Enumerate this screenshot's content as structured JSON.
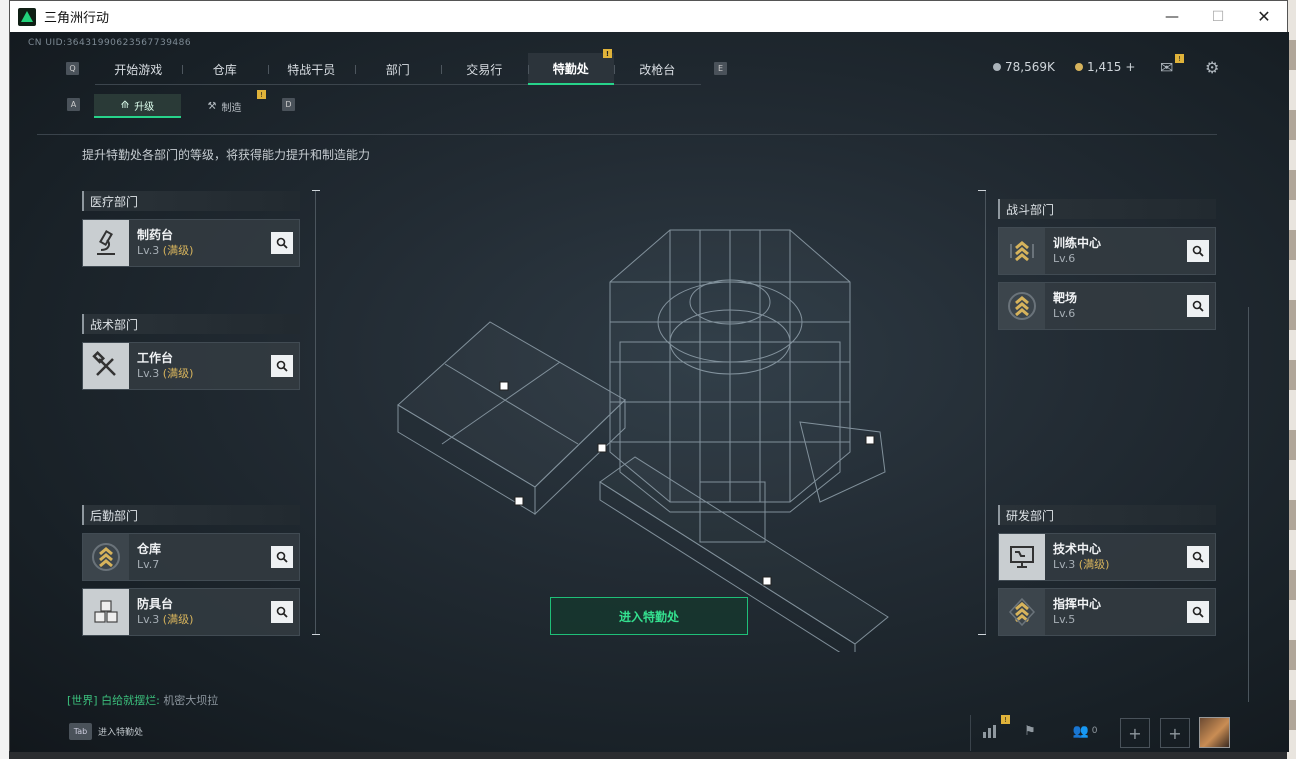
{
  "window": {
    "title": "三角洲行动",
    "controls": [
      "—",
      "☐",
      "✕"
    ]
  },
  "uid": "CN UID:3643199062356773948​6",
  "topnav": {
    "key_left": "Q",
    "key_right": "E",
    "tabs": [
      {
        "label": "开始游戏"
      },
      {
        "label": "仓库"
      },
      {
        "label": "特战干员"
      },
      {
        "label": "部门"
      },
      {
        "label": "交易行"
      },
      {
        "label": "特勤处",
        "active": true,
        "badge": "!"
      },
      {
        "label": "改枪台"
      }
    ]
  },
  "currency": {
    "silver": "78,569K",
    "gold": "1,415",
    "gold_add": "+"
  },
  "subnav": {
    "key_left": "A",
    "key_right": "D",
    "tabs": [
      {
        "label": "升级",
        "active": true
      },
      {
        "label": "制造",
        "badge": "!"
      }
    ]
  },
  "description": "提升特勤处各部门的等级，将获得能力提升和制造能力",
  "max_tag": "(满级)",
  "departments": {
    "medical": {
      "title": "医疗部门",
      "items": [
        {
          "name": "制药台",
          "level": "Lv.3",
          "max": true,
          "icon": "microscope-icon"
        }
      ]
    },
    "tactical": {
      "title": "战术部门",
      "items": [
        {
          "name": "工作台",
          "level": "Lv.3",
          "max": true,
          "icon": "hammer-wrench-icon"
        }
      ]
    },
    "logistics": {
      "title": "后勤部门",
      "items": [
        {
          "name": "仓库",
          "level": "Lv.7",
          "max": false,
          "icon": "chevron-rank-icon"
        },
        {
          "name": "防具台",
          "level": "Lv.3",
          "max": true,
          "icon": "cubes-icon"
        }
      ]
    },
    "combat": {
      "title": "战斗部门",
      "items": [
        {
          "name": "训练中心",
          "level": "Lv.6",
          "max": false,
          "icon": "chevron-rank-icon"
        },
        {
          "name": "靶场",
          "level": "Lv.6",
          "max": false,
          "icon": "chevron-rank-icon"
        }
      ]
    },
    "research": {
      "title": "研发部门",
      "items": [
        {
          "name": "技术中心",
          "level": "Lv.3",
          "max": true,
          "icon": "monitor-icon"
        },
        {
          "name": "指挥中心",
          "level": "Lv.5",
          "max": false,
          "icon": "chevron-rank-icon"
        }
      ]
    }
  },
  "enter_button": "进入特勤处",
  "chat": {
    "channel": "[世界]",
    "sender": "白给就摆烂:",
    "message": "机密大坝拉"
  },
  "bottom_hint": {
    "key": "Tab",
    "label": "进入特勤处"
  },
  "bottom_bar": {
    "friends_count": "0",
    "badge": "!"
  },
  "colors": {
    "accent": "#27d38a",
    "max_level": "#d6b35c",
    "badge": "#e0b33a"
  }
}
